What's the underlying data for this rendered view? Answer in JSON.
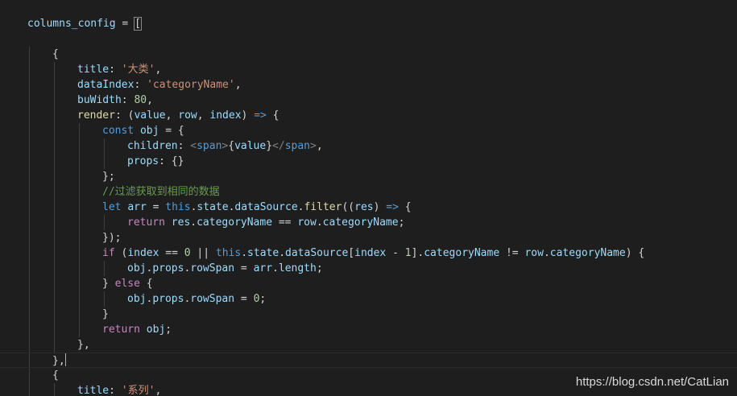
{
  "editor": {
    "theme_colors": {
      "background": "#1e1e1e",
      "property": "#9cdcfe",
      "string": "#ce9178",
      "number": "#b5cea8",
      "keyword": "#569cd6",
      "control": "#c586c0",
      "function": "#dcdcaa",
      "comment": "#6a9955"
    },
    "lines": [
      {
        "indent": 1,
        "tokens": [
          [
            "var",
            "columns_config"
          ],
          [
            "plain",
            " = "
          ],
          [
            "bracket",
            "["
          ]
        ]
      },
      {
        "indent": 0,
        "tokens": []
      },
      {
        "indent": 2,
        "tokens": [
          [
            "plain",
            "{"
          ]
        ]
      },
      {
        "indent": 3,
        "tokens": [
          [
            "prop",
            "title"
          ],
          [
            "plain",
            ": "
          ],
          [
            "str",
            "'大类'"
          ],
          [
            "plain",
            ","
          ]
        ]
      },
      {
        "indent": 3,
        "tokens": [
          [
            "prop",
            "dataIndex"
          ],
          [
            "plain",
            ": "
          ],
          [
            "str",
            "'categoryName'"
          ],
          [
            "plain",
            ","
          ]
        ]
      },
      {
        "indent": 3,
        "tokens": [
          [
            "prop",
            "buWidth"
          ],
          [
            "plain",
            ": "
          ],
          [
            "num",
            "80"
          ],
          [
            "plain",
            ","
          ]
        ]
      },
      {
        "indent": 3,
        "tokens": [
          [
            "fn",
            "render"
          ],
          [
            "plain",
            ": ("
          ],
          [
            "var",
            "value"
          ],
          [
            "plain",
            ", "
          ],
          [
            "var",
            "row"
          ],
          [
            "plain",
            ", "
          ],
          [
            "var",
            "index"
          ],
          [
            "plain",
            ") "
          ],
          [
            "kw",
            "=>"
          ],
          [
            "plain",
            " {"
          ]
        ]
      },
      {
        "indent": 4,
        "tokens": [
          [
            "kw",
            "const"
          ],
          [
            "plain",
            " "
          ],
          [
            "var",
            "obj"
          ],
          [
            "plain",
            " = {"
          ]
        ]
      },
      {
        "indent": 5,
        "tokens": [
          [
            "prop",
            "children"
          ],
          [
            "plain",
            ": "
          ],
          [
            "tag",
            "<"
          ],
          [
            "tagn",
            "span"
          ],
          [
            "tag",
            ">"
          ],
          [
            "plain",
            "{"
          ],
          [
            "var",
            "value"
          ],
          [
            "plain",
            "}"
          ],
          [
            "tag",
            "</"
          ],
          [
            "tagn",
            "span"
          ],
          [
            "tag",
            ">"
          ],
          [
            "plain",
            ","
          ]
        ]
      },
      {
        "indent": 5,
        "tokens": [
          [
            "prop",
            "props"
          ],
          [
            "plain",
            ": {}"
          ]
        ]
      },
      {
        "indent": 4,
        "tokens": [
          [
            "plain",
            "};"
          ]
        ]
      },
      {
        "indent": 4,
        "tokens": [
          [
            "cmt",
            "//过滤获取到相同的数据"
          ]
        ]
      },
      {
        "indent": 4,
        "tokens": [
          [
            "kw",
            "let"
          ],
          [
            "plain",
            " "
          ],
          [
            "var",
            "arr"
          ],
          [
            "plain",
            " = "
          ],
          [
            "kw",
            "this"
          ],
          [
            "plain",
            "."
          ],
          [
            "var",
            "state"
          ],
          [
            "plain",
            "."
          ],
          [
            "var",
            "dataSource"
          ],
          [
            "plain",
            "."
          ],
          [
            "fn",
            "filter"
          ],
          [
            "plain",
            "(("
          ],
          [
            "var",
            "res"
          ],
          [
            "plain",
            ") "
          ],
          [
            "kw",
            "=>"
          ],
          [
            "plain",
            " {"
          ]
        ]
      },
      {
        "indent": 5,
        "tokens": [
          [
            "ctrl",
            "return"
          ],
          [
            "plain",
            " "
          ],
          [
            "var",
            "res"
          ],
          [
            "plain",
            "."
          ],
          [
            "var",
            "categoryName"
          ],
          [
            "plain",
            " == "
          ],
          [
            "var",
            "row"
          ],
          [
            "plain",
            "."
          ],
          [
            "var",
            "categoryName"
          ],
          [
            "plain",
            ";"
          ]
        ]
      },
      {
        "indent": 4,
        "tokens": [
          [
            "plain",
            "});"
          ]
        ]
      },
      {
        "indent": 4,
        "tokens": [
          [
            "ctrl",
            "if"
          ],
          [
            "plain",
            " ("
          ],
          [
            "var",
            "index"
          ],
          [
            "plain",
            " == "
          ],
          [
            "num",
            "0"
          ],
          [
            "plain",
            " || "
          ],
          [
            "kw",
            "this"
          ],
          [
            "plain",
            "."
          ],
          [
            "var",
            "state"
          ],
          [
            "plain",
            "."
          ],
          [
            "var",
            "dataSource"
          ],
          [
            "plain",
            "["
          ],
          [
            "var",
            "index"
          ],
          [
            "plain",
            " - "
          ],
          [
            "num",
            "1"
          ],
          [
            "plain",
            "]."
          ],
          [
            "var",
            "categoryName"
          ],
          [
            "plain",
            " != "
          ],
          [
            "var",
            "row"
          ],
          [
            "plain",
            "."
          ],
          [
            "var",
            "categoryName"
          ],
          [
            "plain",
            ") {"
          ]
        ]
      },
      {
        "indent": 5,
        "tokens": [
          [
            "var",
            "obj"
          ],
          [
            "plain",
            "."
          ],
          [
            "var",
            "props"
          ],
          [
            "plain",
            "."
          ],
          [
            "var",
            "rowSpan"
          ],
          [
            "plain",
            " = "
          ],
          [
            "var",
            "arr"
          ],
          [
            "plain",
            "."
          ],
          [
            "var",
            "length"
          ],
          [
            "plain",
            ";"
          ]
        ]
      },
      {
        "indent": 4,
        "tokens": [
          [
            "plain",
            "} "
          ],
          [
            "ctrl",
            "else"
          ],
          [
            "plain",
            " {"
          ]
        ]
      },
      {
        "indent": 5,
        "tokens": [
          [
            "var",
            "obj"
          ],
          [
            "plain",
            "."
          ],
          [
            "var",
            "props"
          ],
          [
            "plain",
            "."
          ],
          [
            "var",
            "rowSpan"
          ],
          [
            "plain",
            " = "
          ],
          [
            "num",
            "0"
          ],
          [
            "plain",
            ";"
          ]
        ]
      },
      {
        "indent": 4,
        "tokens": [
          [
            "plain",
            "}"
          ]
        ]
      },
      {
        "indent": 4,
        "tokens": [
          [
            "ctrl",
            "return"
          ],
          [
            "plain",
            " "
          ],
          [
            "var",
            "obj"
          ],
          [
            "plain",
            ";"
          ]
        ]
      },
      {
        "indent": 3,
        "tokens": [
          [
            "plain",
            "},"
          ]
        ]
      },
      {
        "indent": 2,
        "tokens": [
          [
            "plain",
            "},"
          ],
          [
            "cursor",
            ""
          ]
        ],
        "current": true
      },
      {
        "indent": 2,
        "tokens": [
          [
            "plain",
            "{"
          ]
        ]
      },
      {
        "indent": 3,
        "tokens": [
          [
            "prop",
            "title"
          ],
          [
            "plain",
            ": "
          ],
          [
            "str",
            "'系列'"
          ],
          [
            "plain",
            ","
          ]
        ]
      }
    ]
  },
  "watermark": "https://blog.csdn.net/CatLian"
}
